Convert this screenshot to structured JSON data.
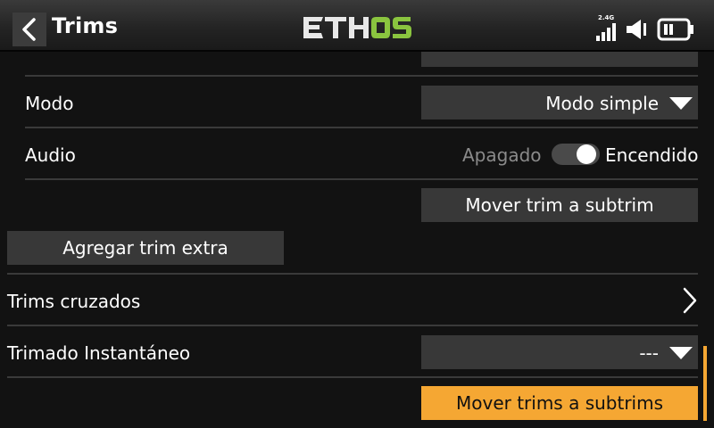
{
  "header": {
    "title": "Trims",
    "logo_text_left": "ETH",
    "logo_text_right": "OS",
    "band": "2.4G",
    "accent": "#f5a733",
    "logo_green": "#8ac43f",
    "icons": [
      "chevron-left-icon",
      "signal-bars-icon",
      "speaker-icon",
      "battery-icon"
    ]
  },
  "settings": {
    "modo_label": "Modo",
    "modo_value": "Modo simple",
    "audio_label": "Audio",
    "audio_off": "Apagado",
    "audio_on": "Encendido",
    "audio_state": "on",
    "move_trim_label": "Mover trim a subtrim",
    "add_trim_label": "Agregar trim extra",
    "cross_trims_label": "Trims cruzados",
    "instant_trim_label": "Trimado Instantáneo",
    "instant_trim_value": "---",
    "move_trims_all_label": "Mover trims a subtrims"
  }
}
